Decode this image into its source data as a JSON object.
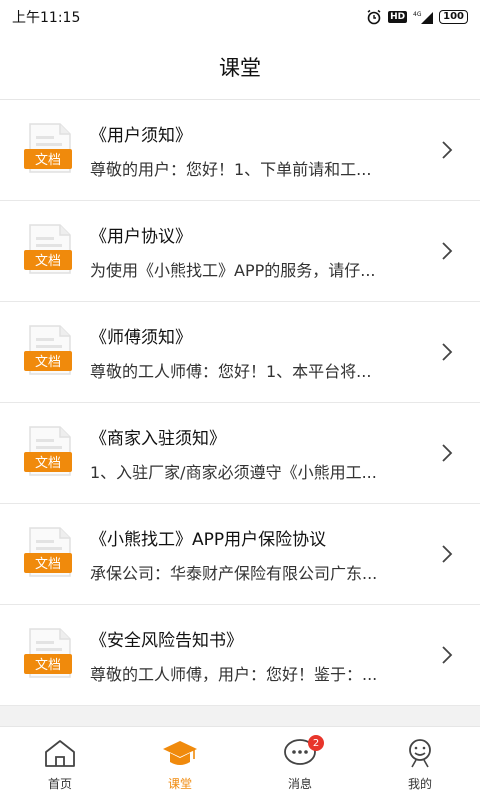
{
  "status_bar": {
    "time": "上午11:15",
    "hd_label": "HD",
    "network_label": "4G",
    "battery": "100"
  },
  "header": {
    "title": "课堂"
  },
  "colors": {
    "accent": "#f08a0c",
    "badge": "#e8352b"
  },
  "doc_badge_label": "文档",
  "documents": [
    {
      "title": "《用户须知》",
      "desc": "尊敬的用户：您好！1、下单前请和工..."
    },
    {
      "title": "《用户协议》",
      "desc": "为使用《小熊找工》APP的服务，请仔..."
    },
    {
      "title": "《师傅须知》",
      "desc": "尊敬的工人师傅：您好！1、本平台将..."
    },
    {
      "title": "《商家入驻须知》",
      "desc": "1、入驻厂家/商家必须遵守《小熊用工..."
    },
    {
      "title": "《小熊找工》APP用户保险协议",
      "desc": "承保公司：华泰财产保险有限公司广东..."
    },
    {
      "title": "《安全风险告知书》",
      "desc": "尊敬的工人师傅，用户：您好！鉴于：..."
    }
  ],
  "tabs": [
    {
      "label": "首页",
      "icon": "home-icon"
    },
    {
      "label": "课堂",
      "icon": "graduation-cap-icon",
      "active": true
    },
    {
      "label": "消息",
      "icon": "chat-bubble-icon",
      "badge": "2"
    },
    {
      "label": "我的",
      "icon": "user-icon"
    }
  ]
}
